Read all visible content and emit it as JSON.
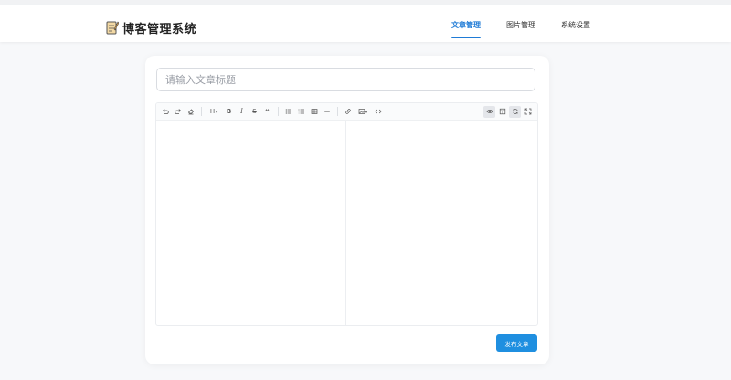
{
  "app": {
    "title": "博客管理系统",
    "accent_color": "#1f7bd6",
    "icon": "notepad-pencil-icon"
  },
  "nav": {
    "items": [
      {
        "label": "文章管理",
        "active": true
      },
      {
        "label": "图片管理",
        "active": false
      },
      {
        "label": "系统设置",
        "active": false
      }
    ]
  },
  "editor": {
    "title_placeholder": "请输入文章标题",
    "title_value": "",
    "toolbar": {
      "undo": "undo-icon",
      "redo": "redo-icon",
      "clear": "eraser-icon",
      "heading_label": "H",
      "bold_label": "B",
      "italic_label": "I",
      "strike_label": "S",
      "quote_label": "❝",
      "ul": "unordered-list-icon",
      "ol": "ordered-list-icon",
      "table": "table-icon",
      "hr": "horizontal-rule-icon",
      "link": "link-icon",
      "image": "image-icon",
      "code": "code-icon",
      "preview": "eye-icon",
      "split": "split-view-icon",
      "sync": "sync-scroll-icon",
      "fullscreen": "fullscreen-icon"
    },
    "markdown_value": ""
  },
  "actions": {
    "publish_label": "发布文章",
    "publish_color": "#1f8fe0"
  }
}
